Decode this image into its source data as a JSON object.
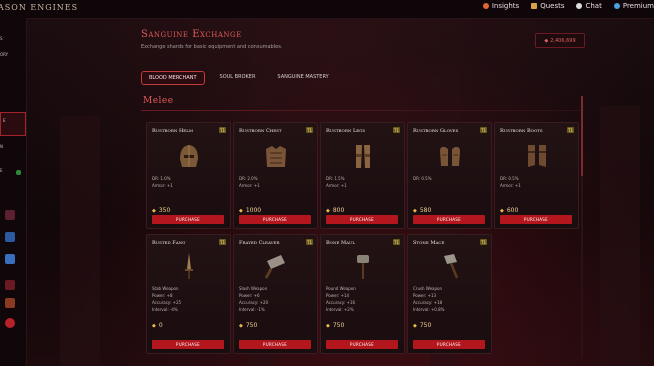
{
  "app": {
    "brand": "ASON ENGINES",
    "nav": [
      {
        "label": "Insights",
        "icon": "insights-icon",
        "color": "#e0662f"
      },
      {
        "label": "Quests",
        "icon": "quests-icon",
        "color": "#d8a24a"
      },
      {
        "label": "Chat",
        "icon": "chat-icon",
        "color": "#dddddd"
      },
      {
        "label": "Premium",
        "icon": "premium-icon",
        "color": "#4aa3e0"
      }
    ]
  },
  "sidebar": {
    "items": [
      {
        "label": "S"
      },
      {
        "label": "ORY"
      },
      {
        "label": "E"
      },
      {
        "label": "N"
      },
      {
        "label": "E"
      }
    ]
  },
  "page": {
    "title": "Sanguine Exchange",
    "subtitle": "Exchange shards for basic equipment and consumables.",
    "currency": "2,406,699",
    "tabs": [
      "BLOOD MERCHANT",
      "SOUL BROKER",
      "SANGUINE MASTERY"
    ],
    "active_tab": "BLOOD MERCHANT",
    "section": "Melee"
  },
  "colors": {
    "accent": "#e25a5a",
    "buy_button": "#b3161d",
    "tier_badge": "#6b5a1a",
    "price_gold": "#e9b94a"
  },
  "shop": {
    "buy_label": "PURCHASE",
    "tier_label": "T1",
    "armor": [
      {
        "name": "Rustborn Helm",
        "art": "helm-icon",
        "stats": [
          "DR: 1.0%",
          "Armor: +1"
        ],
        "price": "350"
      },
      {
        "name": "Rustborn Chest",
        "art": "chest-armor-icon",
        "stats": [
          "DR: 2.0%",
          "Armor: +1"
        ],
        "price": "1000"
      },
      {
        "name": "Rustborn Legs",
        "art": "leg-armor-icon",
        "stats": [
          "DR: 1.5%",
          "Armor: +1"
        ],
        "price": "800"
      },
      {
        "name": "Rustborn Gloves",
        "art": "gloves-icon",
        "stats": [
          "DR: 0.5%",
          ""
        ],
        "price": "580"
      },
      {
        "name": "Rustborn Boots",
        "art": "boots-icon",
        "stats": [
          "DR: 0.5%",
          "Armor: +1"
        ],
        "price": "600"
      }
    ],
    "weapons": [
      {
        "name": "Rusted Fang",
        "art": "dagger-icon",
        "stats": [
          "Stab Weapon",
          "Power: +8",
          "Accuracy: +25",
          "Interval: -4%"
        ],
        "price": "0"
      },
      {
        "name": "Frayed Cleaver",
        "art": "cleaver-icon",
        "stats": [
          "Slash Weapon",
          "Power: +6",
          "Accuracy: +20",
          "Interval: -1%"
        ],
        "price": "750"
      },
      {
        "name": "Bone Maul",
        "art": "maul-icon",
        "stats": [
          "Pound Weapon",
          "Power: +14",
          "Accuracy: +16",
          "Interval: +2%"
        ],
        "price": "750"
      },
      {
        "name": "Stone Mace",
        "art": "mace-icon",
        "stats": [
          "Crush Weapon",
          "Power: +13",
          "Accuracy: +18",
          "Interval: +0.8%"
        ],
        "price": "750"
      }
    ]
  }
}
